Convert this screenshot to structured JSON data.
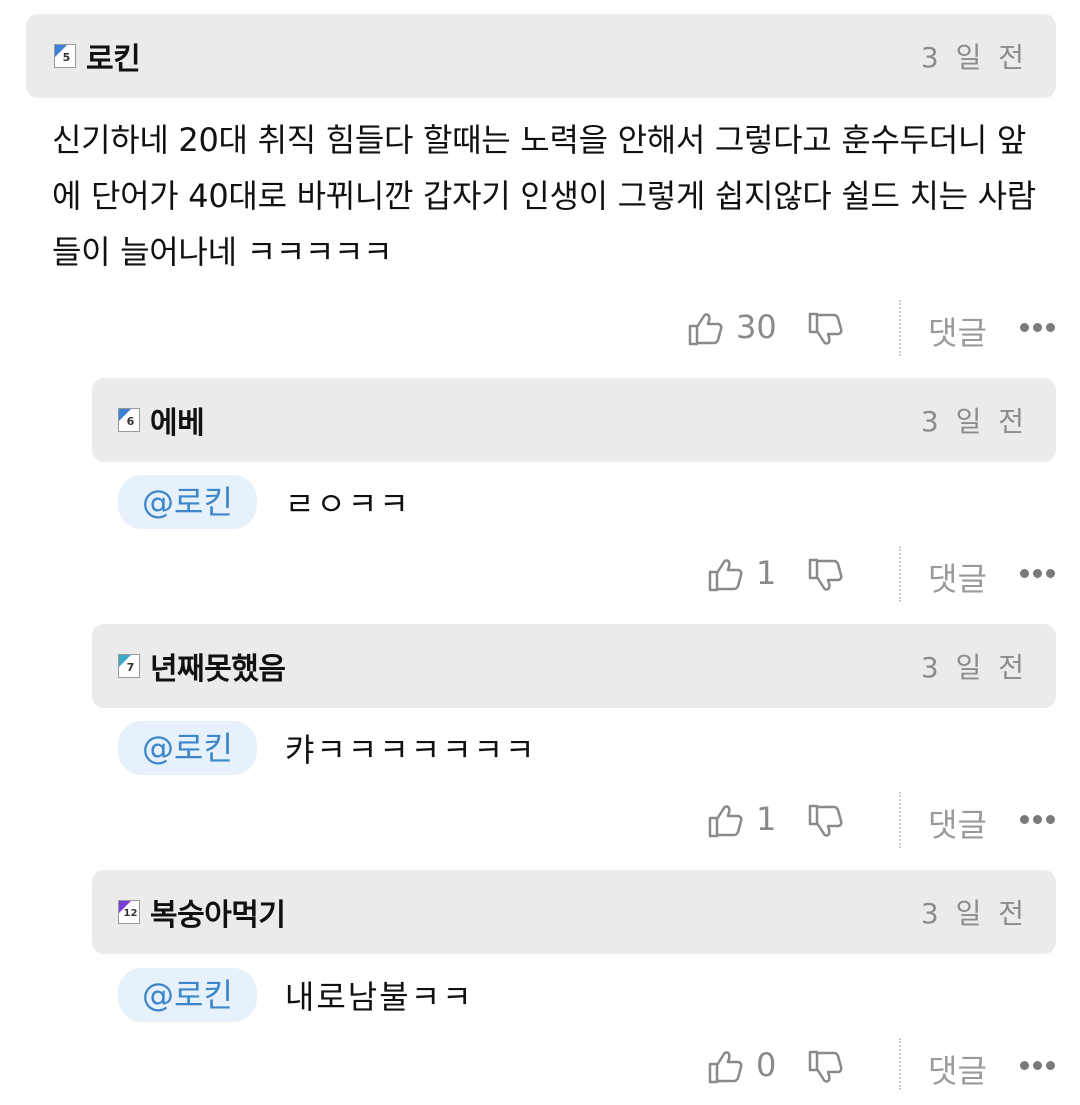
{
  "comments": [
    {
      "level": "5",
      "level_color": "#3b82d6",
      "author": "로킨",
      "time": "3 일 전",
      "text": "신기하네 20대 취직 힘들다 할때는 노력을 안해서 그렇다고 훈수두더니 앞에 단어가 40대로 바뀌니깐 갑자기 인생이 그렇게 쉽지않다 쉴드 치는 사람들이 늘어나네 ㅋㅋㅋㅋㅋ",
      "likes": "30",
      "reply_label": "댓글"
    }
  ],
  "replies": [
    {
      "level": "6",
      "level_color": "#3b82d6",
      "author": "에베",
      "time": "3 일 전",
      "mention": "@로킨",
      "text": "ㄹㅇㅋㅋ",
      "likes": "1",
      "reply_label": "댓글"
    },
    {
      "level": "7",
      "level_color": "#3fa9c9",
      "author": "년째못했음",
      "time": "3 일 전",
      "mention": "@로킨",
      "text": "캬ㅋㅋㅋㅋㅋㅋㅋ",
      "likes": "1",
      "reply_label": "댓글"
    },
    {
      "level": "12",
      "level_color": "#7b3fd6",
      "author": "복숭아먹기",
      "time": "3 일 전",
      "mention": "@로킨",
      "text": "내로남불ㅋㅋ",
      "likes": "0",
      "reply_label": "댓글"
    }
  ],
  "icons": {
    "like": "thumbs-up-icon",
    "dislike": "thumbs-down-icon",
    "more": "more-dots-icon",
    "level": "level-badge-icon"
  }
}
